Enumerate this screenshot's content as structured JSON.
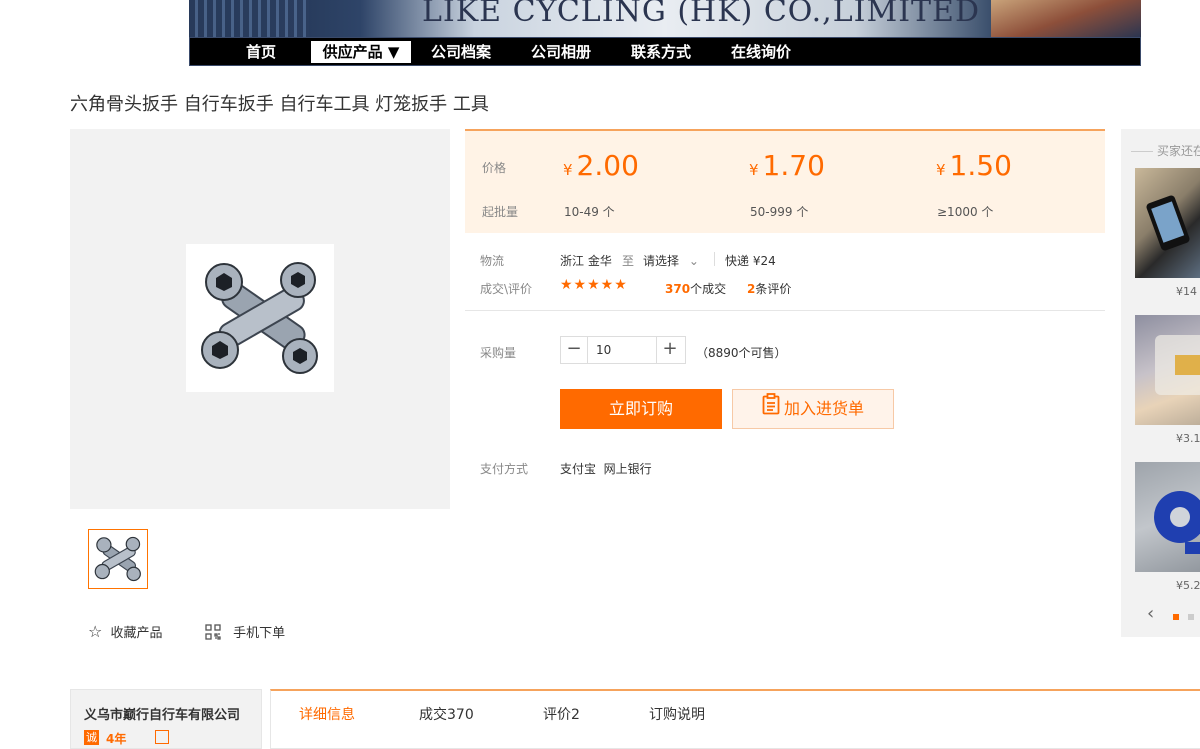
{
  "header": {
    "company_banner": "LIKE CYCLING (HK) CO.,LIMITED",
    "nav": [
      "首页",
      "供应产品 ▼",
      "公司档案",
      "公司相册",
      "联系方式",
      "在线询价"
    ]
  },
  "product": {
    "title": "六角骨头扳手 自行车扳手 自行车工具 灯笼扳手 工具"
  },
  "gallery": {
    "favorite_label": "收藏产品",
    "mobile_order_label": "手机下单"
  },
  "pricing": {
    "price_label": "价格",
    "min_qty_label": "起批量",
    "currency": "¥",
    "tiers": [
      {
        "price": "2.00",
        "qty": "10-49 个"
      },
      {
        "price": "1.70",
        "qty": "50-999 个"
      },
      {
        "price": "1.50",
        "qty": "≥1000 个"
      }
    ]
  },
  "logistics": {
    "label": "物流",
    "origin": "浙江 金华",
    "to": "至",
    "destination": "请选择",
    "shipping": "快递 ¥24"
  },
  "deals": {
    "label": "成交\\评价",
    "rating": 5,
    "sold_count": "370",
    "sold_suffix": "个成交",
    "review_count": "2",
    "review_suffix": "条评价"
  },
  "purchase": {
    "label": "采购量",
    "quantity": "10",
    "available": "（8890个可售）",
    "buy_now": "立即订购",
    "add_to_list": "加入进货单"
  },
  "payment": {
    "label": "支付方式",
    "methods": "支付宝  网上银行"
  },
  "rail": {
    "header": "买家还在",
    "items": [
      {
        "price": "¥14"
      },
      {
        "price": "¥3.1"
      },
      {
        "price": "¥5.2"
      }
    ]
  },
  "shop": {
    "name": "义乌市巅行自行车有限公司",
    "badge": "诚",
    "years": "4年"
  },
  "tabs": [
    "详细信息",
    "成交370",
    "评价2",
    "订购说明"
  ],
  "colors": {
    "accent": "#ff6a00",
    "price_bg": "#fff3e6"
  }
}
